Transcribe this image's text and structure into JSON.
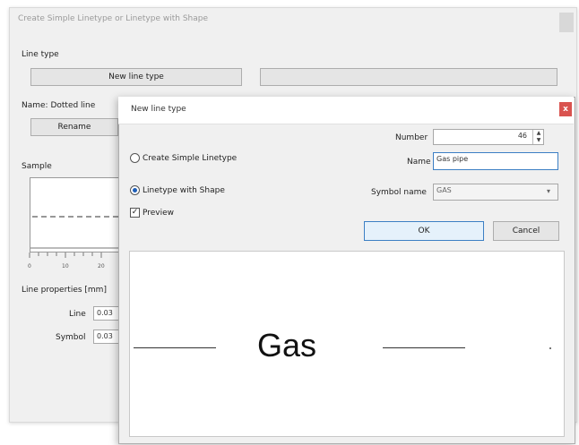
{
  "back": {
    "title": "Create Simple Linetype or Linetype with Shape",
    "line_type_label": "Line type",
    "new_line_type_button": "New line type",
    "name_label": "Name: Dotted line",
    "rename_button": "Rename",
    "sample_label": "Sample",
    "axis_ticks": [
      "0",
      "10",
      "20"
    ],
    "line_properties_label": "Line properties [mm]",
    "line_label": "Line",
    "line_value": "0.03",
    "symbol_label": "Symbol",
    "symbol_value": "0.03"
  },
  "dialog": {
    "title": "New line type",
    "close_glyph": "x",
    "number_label": "Number",
    "number_value": "46",
    "name_label": "Name",
    "name_value": "Gas pipe",
    "symbol_name_label": "Symbol name",
    "symbol_name_value": "GAS",
    "radio_simple": "Create Simple Linetype",
    "radio_shape": "Linetype with Shape",
    "preview_label": "Preview",
    "ok_button": "OK",
    "cancel_button": "Cancel",
    "preview_text": "Gas",
    "radio_shape_selected": true,
    "preview_checked": true
  },
  "colors": {
    "close_button": "#d9534f",
    "ok_highlight": "#3c7fc4",
    "radio_dot": "#1e5eb8"
  }
}
